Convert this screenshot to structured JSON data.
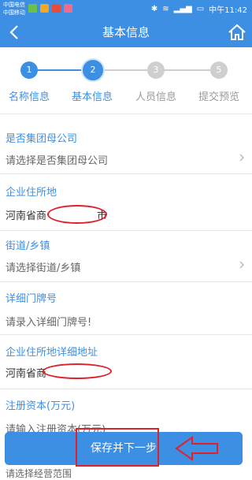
{
  "status_bar": {
    "carrier_line1": "中国电信",
    "carrier_line2": "中国移动",
    "right_text": "中午11:42"
  },
  "nav": {
    "title": "基本信息"
  },
  "steps": [
    {
      "number": "1",
      "label": "名称信息",
      "state": "done"
    },
    {
      "number": "2",
      "label": "基本信息",
      "state": "current"
    },
    {
      "number": "3",
      "label": "人员信息",
      "state": "todo"
    },
    {
      "number": "5",
      "label": "提交预览",
      "state": "todo"
    }
  ],
  "form": {
    "group_company": {
      "label": "是否集团母公司",
      "value": "请选择是否集团母公司"
    },
    "address": {
      "label": "企业住所地",
      "value_prefix": "河南省商",
      "value_suffix": "市"
    },
    "street": {
      "label": "街道/乡镇",
      "value": "请选择街道/乡镇"
    },
    "door_number": {
      "label": "详细门牌号",
      "value": "请录入详细门牌号!"
    },
    "detailed_address": {
      "label": "企业住所地详细地址",
      "value_prefix": "河南省商"
    },
    "capital": {
      "label": "注册资本(万元)",
      "value": "请输入注册资本(万元)"
    },
    "bottom_peek": "请选择经营范围"
  },
  "submit": {
    "label": "保存并下一步"
  },
  "colors": {
    "primary": "#3d8fe4",
    "annotation_red": "#e0202a"
  }
}
